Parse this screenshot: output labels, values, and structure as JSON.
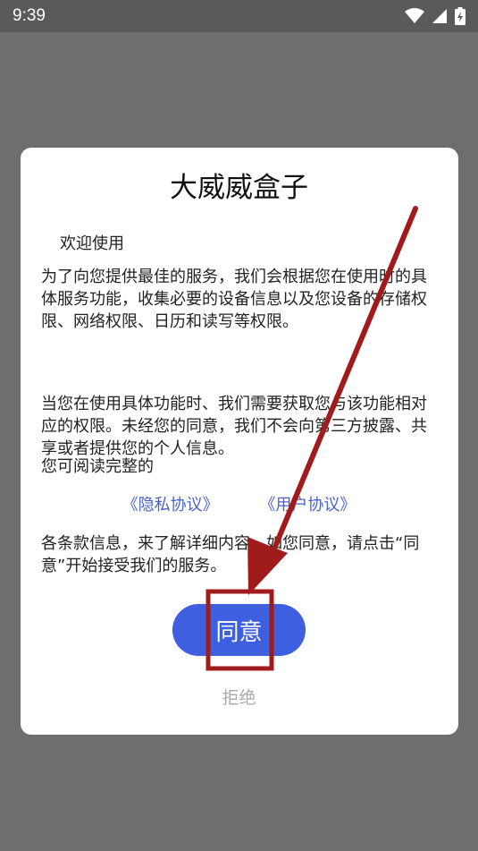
{
  "status_bar": {
    "time": "9:39"
  },
  "dialog": {
    "title": "大威威盒子",
    "welcome": "欢迎使用",
    "paragraph1": "为了向您提供最佳的服务，我们会根据您在使用时的具体服务功能，收集必要的设备信息以及您设备的存储权限、网络权限、日历和读写等权限。",
    "paragraph2": "当您在使用具体功能时、我们需要获取您与该功能相对应的权限。未经您的同意，我们不会向第三方披露、共享或者提供您的个人信息。",
    "paragraph3": "您可阅读完整的",
    "privacy_link": "《隐私协议》",
    "user_link": "《用户协议》",
    "paragraph4": "各条款信息，来了解详细内容。如您同意，请点击“同意”开始接受我们的服务。",
    "agree_label": "同意",
    "reject_label": "拒绝"
  },
  "colors": {
    "accent": "#3e5fe0",
    "link": "#4a63c9",
    "annotation": "#a01c1c",
    "overlay": "#6e6e6e"
  }
}
